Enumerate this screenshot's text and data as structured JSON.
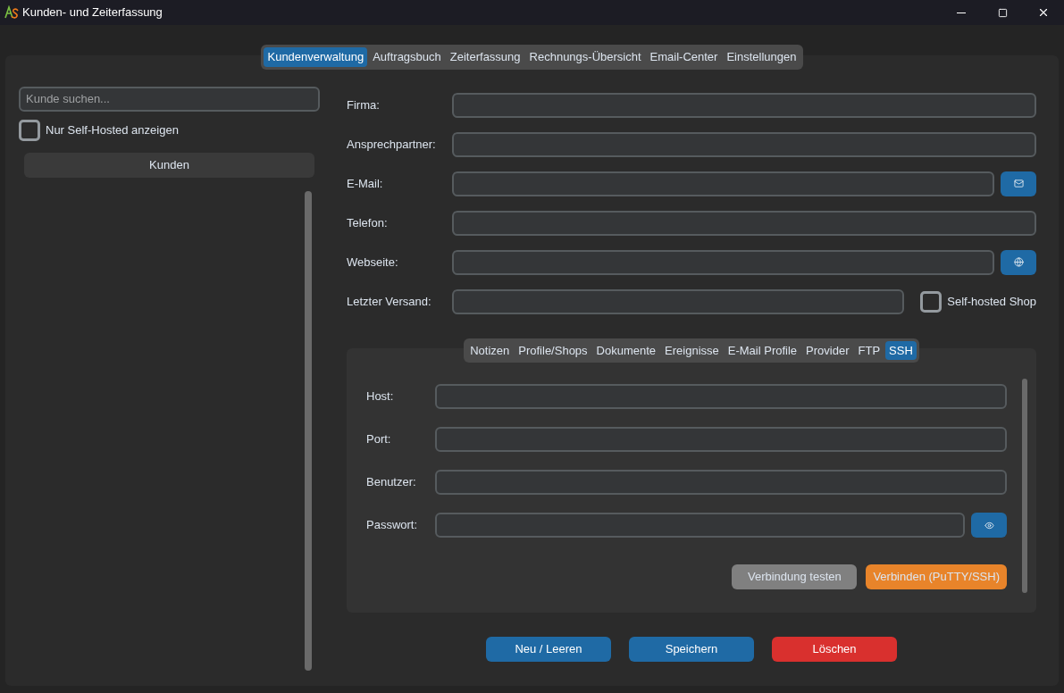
{
  "window": {
    "title": "Kunden- und Zeiterfassung"
  },
  "tabs": [
    {
      "label": "Kundenverwaltung",
      "selected": true
    },
    {
      "label": "Auftragsbuch",
      "selected": false
    },
    {
      "label": "Zeiterfassung",
      "selected": false
    },
    {
      "label": "Rechnungs-Übersicht",
      "selected": false
    },
    {
      "label": "Email-Center",
      "selected": false
    },
    {
      "label": "Einstellungen",
      "selected": false
    }
  ],
  "search": {
    "placeholder": "Kunde suchen..."
  },
  "filter": {
    "label": "Nur Self-Hosted anzeigen",
    "checked": false
  },
  "list": {
    "header": "Kunden"
  },
  "fields": [
    {
      "label": "Firma:",
      "kind": "plain"
    },
    {
      "label": "Ansprechpartner:",
      "kind": "plain"
    },
    {
      "label": "E-Mail:",
      "kind": "mail"
    },
    {
      "label": "Telefon:",
      "kind": "plain"
    },
    {
      "label": "Webseite:",
      "kind": "web"
    },
    {
      "label": "Letzter Versand:",
      "kind": "check",
      "check_label": "Self-hosted Shop",
      "checked": false
    }
  ],
  "subtabs": [
    {
      "label": "Notizen",
      "selected": false
    },
    {
      "label": "Profile/Shops",
      "selected": false
    },
    {
      "label": "Dokumente",
      "selected": false
    },
    {
      "label": "Ereignisse",
      "selected": false
    },
    {
      "label": "E-Mail Profile",
      "selected": false
    },
    {
      "label": "Provider",
      "selected": false
    },
    {
      "label": "FTP",
      "selected": false
    },
    {
      "label": "SSH",
      "selected": true
    }
  ],
  "ssh": {
    "fields": [
      {
        "label": "Host:",
        "kind": "plain"
      },
      {
        "label": "Port:",
        "kind": "plain"
      },
      {
        "label": "Benutzer:",
        "kind": "plain"
      },
      {
        "label": "Passwort:",
        "kind": "password"
      }
    ],
    "buttons": [
      {
        "label": "Verbindung testen",
        "color": "#808080"
      },
      {
        "label": "Verbinden (PuTTY/SSH)",
        "color": "#e8842a"
      }
    ]
  },
  "actions": [
    {
      "label": "Neu / Leeren",
      "color": "#1f6aa5"
    },
    {
      "label": "Speichern",
      "color": "#1f6aa5"
    },
    {
      "label": "Löschen",
      "color": "#d9302e"
    }
  ]
}
